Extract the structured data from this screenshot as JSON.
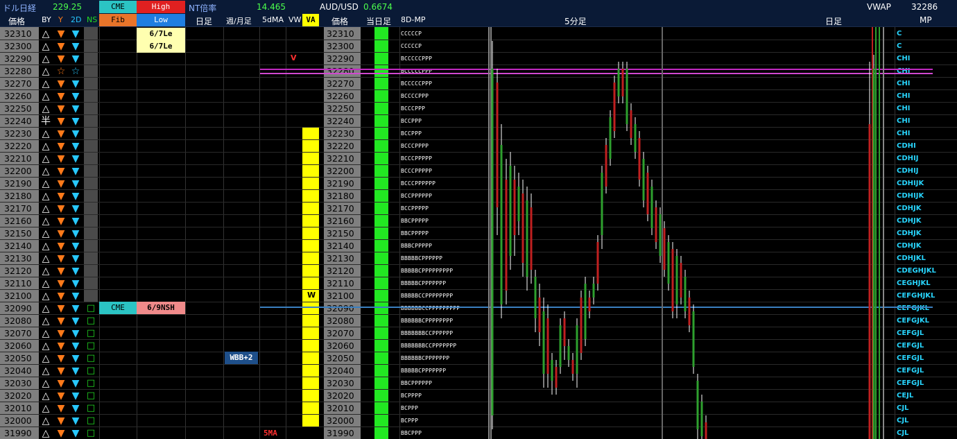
{
  "header": {
    "dollar_nikkei_label": "ドル日経",
    "dollar_nikkei_value": "229.25",
    "cme_label": "CME",
    "high_label": "High",
    "fib_label": "Fib",
    "low_label": "Low",
    "nt_label": "NT倍率",
    "nt_value": "14.465",
    "audusd_label": "AUD/USD",
    "audusd_value": "0.6674",
    "vwap_label": "VWAP",
    "vwap_value": "32286"
  },
  "columns": {
    "price": "価格",
    "by": "BY",
    "y": "Y",
    "d2": "2D",
    "ns": "NS",
    "daily": "日足",
    "weekly_monthly": "週/月足",
    "ma5": "5dMA",
    "vw": "VW",
    "va": "VA",
    "price2": "価格",
    "today": "当日足",
    "mp8d": "8D-MP",
    "min5": "5分足",
    "daily2": "日足",
    "mp": "MP"
  },
  "tags": {
    "le1": "6/7Le",
    "le2": "6/7Le",
    "cme2": "CME",
    "nsh": "6/9NSH",
    "wbb": "WBB+2",
    "ma5_bottom": "5MA",
    "v_mark": "V",
    "w_mark": "W"
  },
  "rows": [
    {
      "price": "32310",
      "by": "△",
      "y": "▼",
      "d2": "▼",
      "ns": "",
      "mp8d": "CCCCCP",
      "tpo": "C"
    },
    {
      "price": "32300",
      "by": "△",
      "y": "▼",
      "d2": "▼",
      "ns": "",
      "mp8d": "CCCCCP",
      "tpo": "C"
    },
    {
      "price": "32290",
      "by": "△",
      "y": "▼",
      "d2": "▼",
      "ns": "",
      "mp8d": "BCCCCCPPP",
      "tpo": "CHI"
    },
    {
      "price": "32280",
      "by": "△",
      "y": "☆",
      "d2": "☆",
      "ns": "",
      "mp8d": "BCCCCCPPP",
      "tpo": "CHI"
    },
    {
      "price": "32270",
      "by": "△",
      "y": "▼",
      "d2": "▼",
      "ns": "",
      "mp8d": "BCCCCCPPP",
      "tpo": "CHI"
    },
    {
      "price": "32260",
      "by": "△",
      "y": "▼",
      "d2": "▼",
      "ns": "",
      "mp8d": "BCCCCPPP",
      "tpo": "CHI"
    },
    {
      "price": "32250",
      "by": "△",
      "y": "▼",
      "d2": "▼",
      "ns": "",
      "mp8d": "BCCCPPP",
      "tpo": "CHI"
    },
    {
      "price": "32240",
      "by": "半",
      "y": "▼",
      "d2": "▼",
      "ns": "",
      "mp8d": "BCCPPP",
      "tpo": "CHI"
    },
    {
      "price": "32230",
      "by": "△",
      "y": "▼",
      "d2": "▼",
      "ns": "",
      "mp8d": "BCCPPP",
      "tpo": "CHI"
    },
    {
      "price": "32220",
      "by": "△",
      "y": "▼",
      "d2": "▼",
      "ns": "",
      "mp8d": "BCCCPPPP",
      "tpo": "CDHI"
    },
    {
      "price": "32210",
      "by": "△",
      "y": "▼",
      "d2": "▼",
      "ns": "",
      "mp8d": "BCCCPPPPP",
      "tpo": "CDHIJ"
    },
    {
      "price": "32200",
      "by": "△",
      "y": "▼",
      "d2": "▼",
      "ns": "",
      "mp8d": "BCCCPPPPP",
      "tpo": "CDHIJ"
    },
    {
      "price": "32190",
      "by": "△",
      "y": "▼",
      "d2": "▼",
      "ns": "",
      "mp8d": "BCCCPPPPPP",
      "tpo": "CDHIJK"
    },
    {
      "price": "32180",
      "by": "△",
      "y": "▼",
      "d2": "▼",
      "ns": "",
      "mp8d": "BCCPPPPPP",
      "tpo": "CDHIJK"
    },
    {
      "price": "32170",
      "by": "△",
      "y": "▼",
      "d2": "▼",
      "ns": "",
      "mp8d": "BCCPPPPP",
      "tpo": "CDHJK"
    },
    {
      "price": "32160",
      "by": "△",
      "y": "▼",
      "d2": "▼",
      "ns": "",
      "mp8d": "BBCPPPPP",
      "tpo": "CDHJK"
    },
    {
      "price": "32150",
      "by": "△",
      "y": "▼",
      "d2": "▼",
      "ns": "",
      "mp8d": "BBCPPPPP",
      "tpo": "CDHJK"
    },
    {
      "price": "32140",
      "by": "△",
      "y": "▼",
      "d2": "▼",
      "ns": "",
      "mp8d": "BBBCPPPPP",
      "tpo": "CDHJK"
    },
    {
      "price": "32130",
      "by": "△",
      "y": "▼",
      "d2": "▼",
      "ns": "",
      "mp8d": "BBBBBCPPPPPP",
      "tpo": "CDHJKL"
    },
    {
      "price": "32120",
      "by": "△",
      "y": "▼",
      "d2": "▼",
      "ns": "",
      "mp8d": "BBBBBCPPPPPPPPP",
      "tpo": "CDEGHJKL"
    },
    {
      "price": "32110",
      "by": "△",
      "y": "▼",
      "d2": "▼",
      "ns": "",
      "mp8d": "BBBBBCPPPPPPP",
      "tpo": "CEGHJKL"
    },
    {
      "price": "32100",
      "by": "△",
      "y": "▼",
      "d2": "▼",
      "ns": "",
      "mp8d": "BBBBBCCPPPPPPPP",
      "tpo": "CEFGHJKL"
    },
    {
      "price": "32090",
      "by": "△",
      "y": "▼",
      "d2": "▼",
      "ns": "□",
      "mp8d": "BBBBBBCCPPPPPPPPP",
      "tpo": "CEFGJKL"
    },
    {
      "price": "32080",
      "by": "△",
      "y": "▼",
      "d2": "▼",
      "ns": "□",
      "mp8d": "BBBBBBCPPPPPPPP",
      "tpo": "CEFGJKL"
    },
    {
      "price": "32070",
      "by": "△",
      "y": "▼",
      "d2": "▼",
      "ns": "□",
      "mp8d": "BBBBBBBCCPPPPPP",
      "tpo": "CEFGJL"
    },
    {
      "price": "32060",
      "by": "△",
      "y": "▼",
      "d2": "▼",
      "ns": "□",
      "mp8d": "BBBBBBBCCPPPPPPP",
      "tpo": "CEFGJL"
    },
    {
      "price": "32050",
      "by": "△",
      "y": "▼",
      "d2": "▼",
      "ns": "□",
      "mp8d": "BBBBBBCPPPPPPP",
      "tpo": "CEFGJL"
    },
    {
      "price": "32040",
      "by": "△",
      "y": "▼",
      "d2": "▼",
      "ns": "□",
      "mp8d": "BBBBBCPPPPPPP",
      "tpo": "CEFGJL"
    },
    {
      "price": "32030",
      "by": "△",
      "y": "▼",
      "d2": "▼",
      "ns": "□",
      "mp8d": "BBCPPPPPP",
      "tpo": "CEFGJL"
    },
    {
      "price": "32020",
      "by": "△",
      "y": "▼",
      "d2": "▼",
      "ns": "□",
      "mp8d": "BCPPPP",
      "tpo": "CEJL"
    },
    {
      "price": "32010",
      "by": "△",
      "y": "▼",
      "d2": "▼",
      "ns": "□",
      "mp8d": "BCPPP",
      "tpo": "CJL"
    },
    {
      "price": "32000",
      "by": "△",
      "y": "▼",
      "d2": "▼",
      "ns": "□",
      "mp8d": "BCPPP",
      "tpo": "CJL"
    },
    {
      "price": "31990",
      "by": "△",
      "y": "▼",
      "d2": "▼",
      "ns": "□",
      "mp8d": "BBCPPP",
      "tpo": "CJL"
    }
  ]
}
